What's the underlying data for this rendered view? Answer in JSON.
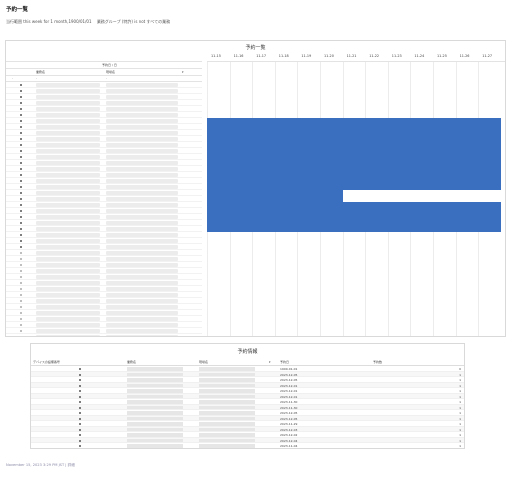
{
  "page": {
    "title": "予約一覧",
    "filter": {
      "date_part": "当行範囲 this week for 1 month,1900/01/01",
      "group_part": "業務グループ (特許) is not すべての業務"
    },
    "footer": "November 15, 2023 3:29 PM JST | 詳細"
  },
  "schedule": {
    "title": "予約一覧",
    "left_headers": {
      "name": "予約一覧",
      "reserved_date": "予約日 / 日",
      "device": "業務名",
      "place": "現場名"
    },
    "dates": [
      "11-15",
      "11-16",
      "11-17",
      "11-18",
      "11-19",
      "11-20",
      "11-21",
      "11-22",
      "11-23",
      "11-24",
      "11-25",
      "11-26",
      "11-27"
    ],
    "row_count": 46,
    "filled_bullets": 28,
    "booking": {
      "from": "11-15",
      "to": "11-27",
      "first_row": 6,
      "last_row": 24,
      "gap_row": 18,
      "gap_from": "11-21"
    }
  },
  "info": {
    "title": "予約情報",
    "headers": {
      "device": "デバイスの設備番号",
      "name": "業務名",
      "place": "現場名",
      "date": "予約日",
      "count": "予約数"
    },
    "rows": [
      {
        "date": "1900-01-01",
        "count": "0"
      },
      {
        "date": "2023-12-05",
        "count": "1"
      },
      {
        "date": "2023-12-05",
        "count": "1"
      },
      {
        "date": "2023-12-01",
        "count": "1"
      },
      {
        "date": "2023-12-01",
        "count": "1"
      },
      {
        "date": "2023-12-01",
        "count": "1"
      },
      {
        "date": "2023-11-30",
        "count": "1"
      },
      {
        "date": "2023-11-30",
        "count": "1"
      },
      {
        "date": "2023-12-05",
        "count": "1"
      },
      {
        "date": "2023-12-05",
        "count": "1"
      },
      {
        "date": "2023-11-29",
        "count": "1"
      },
      {
        "date": "2023-12-03",
        "count": "1"
      },
      {
        "date": "2023-12-02",
        "count": "1"
      },
      {
        "date": "2023-12-04",
        "count": "1"
      },
      {
        "date": "2023-11-04",
        "count": "1"
      }
    ]
  },
  "colors": {
    "booking": "#3a6fbf",
    "border": "#d9d9d9"
  }
}
